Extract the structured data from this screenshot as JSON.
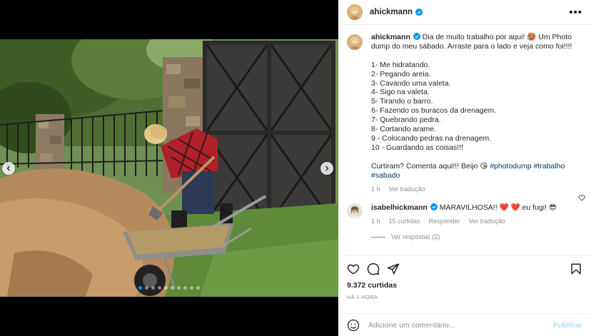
{
  "post": {
    "username": "ahickmann",
    "verified": true,
    "more_label": "•••",
    "caption_user": "ahickmann",
    "caption_text": " Dia de muito trabalho por aqui! 🥵 Um Photo dump do meu sábado. Arraste para o lado e veja como foi!!!!\n\n1- Me hidratando.\n2- Pegando areia.\n3- Cavando uma valeta.\n4- Sigo na valeta.\n5- Tirando o barro.\n6- Fazendo os buracos da drenagem.\n7- Quebrando pedra.\n8- Cortando arame.\n9 - Colocando pedras na drenagem.\n10 - Guardando as coisas!!!\n\nCurtiram? Comenta aqui!!! Beijo 😘 ",
    "hashtags": [
      "#photodump",
      "#trabalho",
      "#sabado"
    ],
    "caption_time": "1 h",
    "caption_translate": "Ver tradução"
  },
  "comment": {
    "username": "isabelhickmann",
    "text": "MARAVILHOSA!! ❤️ ❤️ eu fugi! 😎",
    "time": "1 h",
    "likes": "15 curtidas",
    "reply": "Responder",
    "translate": "Ver tradução",
    "view_replies": "Ver respostas (2)"
  },
  "stats": {
    "likes": "9.372 curtidas",
    "time": "HÁ 1 HORA"
  },
  "add_comment": {
    "placeholder": "Adicione um comentário...",
    "publish": "Publicar"
  },
  "icons": {
    "prev": "chevron-left-icon",
    "next": "chevron-right-icon",
    "like": "heart-icon",
    "comment": "comment-icon",
    "share": "paper-plane-icon",
    "save": "bookmark-icon",
    "emoji": "smiley-icon",
    "verified": "verified-badge-icon"
  },
  "carousel": {
    "total": 10,
    "current": 1
  },
  "colors": {
    "link": "#00376b",
    "accent": "#0095f6",
    "muted": "#8e8e8e",
    "publish_disabled": "#b2dffc"
  }
}
